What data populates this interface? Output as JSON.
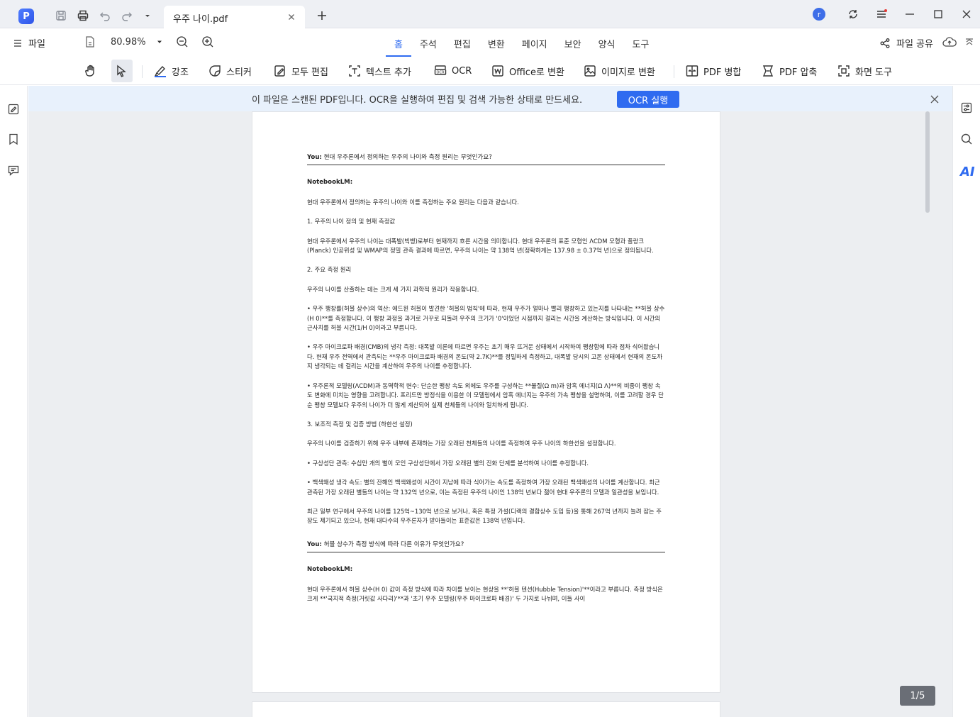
{
  "titlebar": {
    "logo": "P",
    "tab_title": "우주 나이.pdf",
    "avatar_letter": "r"
  },
  "menubar": {
    "file_label": "파일",
    "zoom": "80.98%",
    "tabs": [
      {
        "label": "홈",
        "active": true
      },
      {
        "label": "주석",
        "active": false
      },
      {
        "label": "편집",
        "active": false
      },
      {
        "label": "변환",
        "active": false
      },
      {
        "label": "페이지",
        "active": false
      },
      {
        "label": "보안",
        "active": false
      },
      {
        "label": "양식",
        "active": false
      },
      {
        "label": "도구",
        "active": false
      }
    ],
    "share_label": "파일 공유"
  },
  "toolbar": {
    "highlight": "강조",
    "sticker": "스티커",
    "edit_all": "모두 편집",
    "add_text": "텍스트 추가",
    "ocr": "OCR",
    "to_office": "Office로 변환",
    "to_image": "이미지로 변환",
    "merge": "PDF 병합",
    "compress": "PDF 압축",
    "screen_tool": "화면 도구"
  },
  "ocr_bar": {
    "message": "이 파일은 스캔된 PDF입니다. OCR을 실행하여 편집 및 검색 가능한 상태로 만드세요.",
    "button": "OCR 실행"
  },
  "document": {
    "q1_label": "You:",
    "q1_text": " 현대 우주론에서 정의하는 우주의 나이와 측정 원리는 무엇인가요?",
    "answer_label": "NotebookLM:",
    "p1": "현대 우주론에서 정의하는 우주의 나이와 이를 측정하는 주요 원리는 다음과 같습니다.",
    "p2": "1. 우주의 나이 정의 및 현재 측정값",
    "p3": "현대 우주론에서 우주의 나이는 대폭발(빅뱅)로부터 현재까지 흐른 시간을 의미합니다. 현대 우주론의 표준 모형인 ΛCDM 모형과 플랑크(Planck) 인공위성 및 WMAP의 정밀 관측 결과에 따르면, 우주의 나이는 약 138억 년(정확하게는 137.98 ± 0.37억 년)으로 정의됩니다.",
    "p4": "2. 주요 측정 원리",
    "p5": "우주의 나이를 산출하는 데는 크게 세 가지 과학적 원리가 작용합니다.",
    "p6": "• 우주 팽창률(허블 상수)의 역산: 에드윈 허블이 발견한 '허블의 법칙'에 따라, 현재 우주가 얼마나 빨리 팽창하고 있는지를 나타내는 **허블 상수(H 0)**를 측정합니다. 이 팽창 과정을 과거로 거꾸로 되돌려 우주의 크기가 '0'이었던 시점까지 걸리는 시간을 계산하는 방식입니다. 이 시간의 근사치를 허블 시간(1/H 0)이라고 부릅니다.",
    "p7": "• 우주 마이크로파 배경(CMB)의 냉각 측정: 대폭발 이론에 따르면 우주는 초기 매우 뜨거운 상태에서 시작하여 팽창함에 따라 점차 식어왔습니다. 현재 우주 전역에서 관측되는 **우주 마이크로파 배경의 온도(약 2.7K)**를 정밀하게 측정하고, 대폭발 당시의 고온 상태에서 현재의 온도까지 냉각되는 데 걸리는 시간을 계산하여 우주의 나이를 추정합니다.",
    "p8": "• 우주론적 모델링(ΛCDM)과 동역학적 변수: 단순한 팽창 속도 외에도 우주를 구성하는 **물질(Ω m)과 암흑 에너지(Ω Λ)**의 비중이 팽창 속도 변화에 미치는 영향을 고려합니다. 프리드만 방정식을 이용한 이 모델링에서 암흑 에너지는 우주의 가속 팽창을 설명하며, 이를 고려할 경우 단순 팽창 모델보다 우주의 나이가 더 많게 계산되어 실제 천체들의 나이와 일치하게 됩니다.",
    "p9": "3. 보조적 측정 및 검증 방법 (하한선 설정)",
    "p10": "우주의 나이를 검증하기 위해 우주 내부에 존재하는 가장 오래된 천체들의 나이를 측정하여 우주 나이의 하한선을 설정합니다.",
    "p11": "• 구상성단 관측: 수십만 개의 별이 모인 구상성단에서 가장 오래된 별의 진화 단계를 분석하여 나이를 추정합니다.",
    "p12": "• 백색왜성 냉각 속도: 별의 잔해인 백색왜성이 시간이 지남에 따라 식어가는 속도를 측정하여 가장 오래된 백색왜성의 나이를 계산합니다. 최근 관측된 가장 오래된 별들의 나이는 약 132억 년으로, 이는 측정된 우주의 나이인 138억 년보다 젊어 현대 우주론의 모델과 일관성을 보입니다.",
    "p13": "최근 일부 연구에서 우주의 나이를 125억~130억 년으로 보거나, 혹은 특정 가설(디랙의 결합상수 도입 등)을 통해 267억 년까지 늘려 잡는 주장도 제기되고 있으나, 현재 대다수의 우주론자가 받아들이는 표준값은 138억 년입니다.",
    "q2_label": "You:",
    "q2_text": " 허블 상수가 측정 방식에 따라 다른 이유가 무엇인가요?",
    "answer2_label": "NotebookLM:",
    "p14": "현대 우주론에서 허블 상수(H 0) 값이 측정 방식에 따라 차이를 보이는 현상을 **'허블 텐션(Hubble Tension)'**이라고 부릅니다. 측정 방식은 크게 **'국지적 측정(거릿값 사다리)'**과 '초기 우주 모델링(우주 마이크로파 배경)' 두 가지로 나뉘며, 이들 사이"
  },
  "page_indicator": "1/5",
  "colors": {
    "accent": "#2f6bf0",
    "ocr_bar_bg": "#e8f1fc"
  }
}
